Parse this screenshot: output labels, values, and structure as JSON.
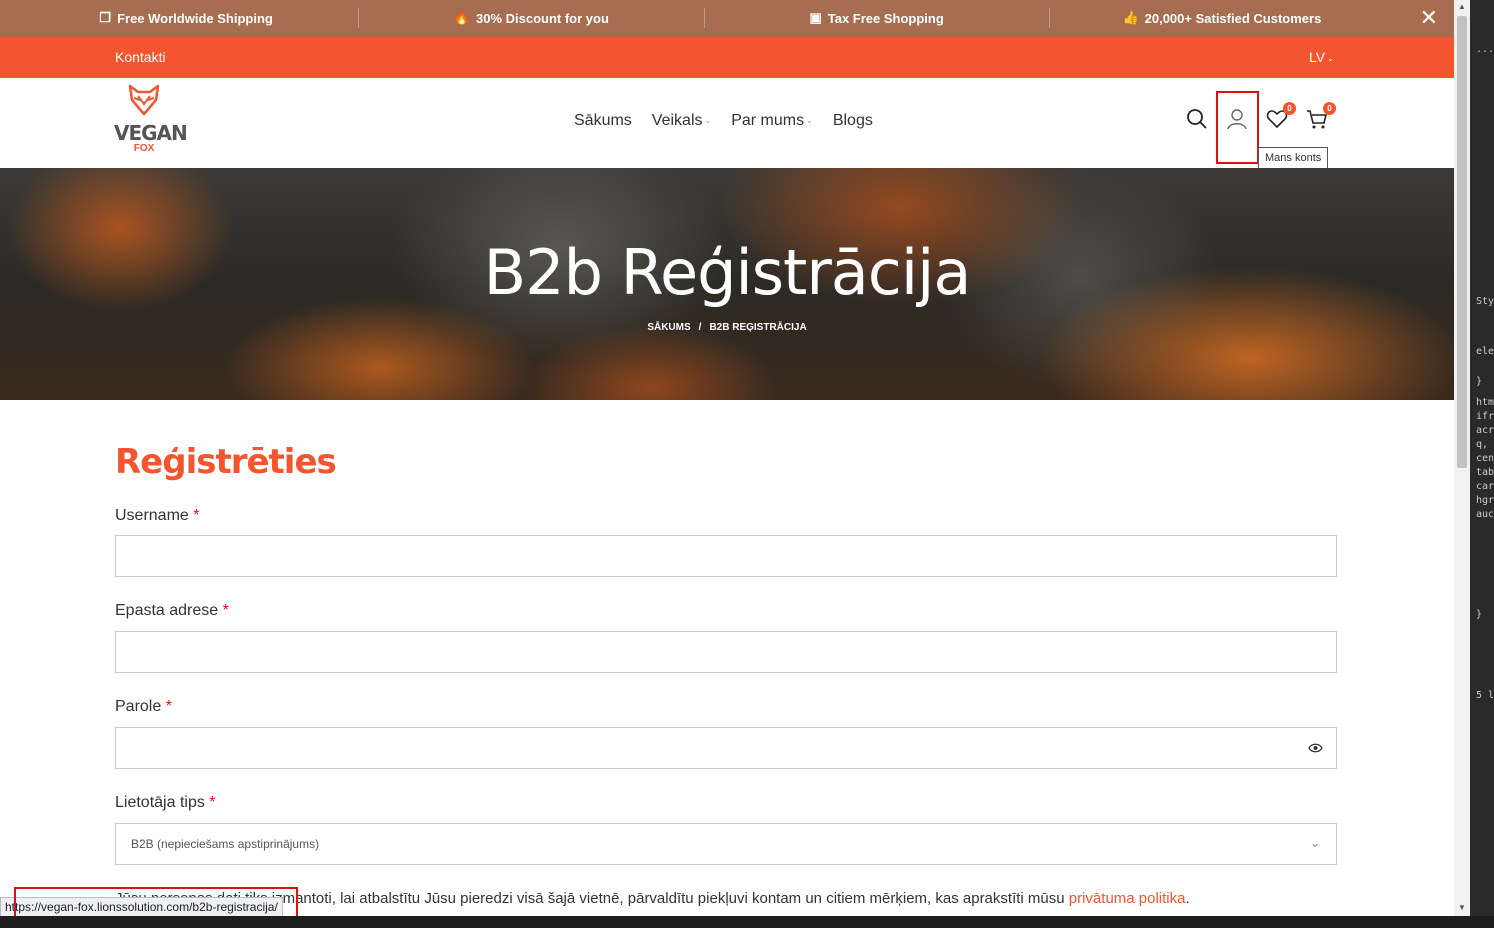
{
  "promo": {
    "items": [
      {
        "icon": "box-icon",
        "glyph": "❒",
        "label": "Free Worldwide Shipping"
      },
      {
        "icon": "fire-icon",
        "glyph": "🔥",
        "label": "30% Discount for you"
      },
      {
        "icon": "money-icon",
        "glyph": "▣",
        "label": "Tax Free Shopping"
      },
      {
        "icon": "thumbs-up-icon",
        "glyph": "👍",
        "label": "20,000+ Satisfied Customers"
      }
    ],
    "close": "✕"
  },
  "topbar": {
    "contact": "Kontakti",
    "lang": "LV"
  },
  "header": {
    "logo_text": "VEGAN",
    "logo_sub": "FOX",
    "nav": [
      {
        "label": "Sākums"
      },
      {
        "label": "Veikals"
      },
      {
        "label": "Par mums"
      },
      {
        "label": "Blogs"
      }
    ],
    "wishlist_count": "0",
    "cart_count": "0",
    "tooltip": "Mans konts"
  },
  "hero": {
    "title": "B2b Reģistrācija",
    "crumb_home": "SĀKUMS",
    "crumb_sep": "/",
    "crumb_current": "B2B REĢISTRĀCIJA"
  },
  "form": {
    "title": "Reģistrēties",
    "username_label": "Username",
    "email_label": "Epasta adrese",
    "password_label": "Parole",
    "usertype_label": "Lietotāja tips",
    "required_mark": "*",
    "usertype_value": "B2B (nepieciešams apstiprinājums)",
    "policy_text": "Jūsu personas dati tiks izmantoti, lai atbalstītu Jūsu pieredzi visā šajā vietnē, pārvaldītu piekļuvi kontam un citiem mērķiem, kas aprakstīti mūsu ",
    "policy_link": "privātuma politika",
    "policy_end": "."
  },
  "status": {
    "url": "https://vegan-fox.lionssolution.com/b2b-registracija/"
  },
  "devtools": {
    "lines": [
      "...",
      "Sty",
      "ele",
      "}",
      "htm",
      "ifr",
      "acr",
      "q,",
      "cen",
      "tab",
      "car",
      "hgr",
      "auc",
      "}",
      "5 l"
    ]
  },
  "colors": {
    "accent": "#f4552f",
    "promo_bg": "#a76d50",
    "highlight": "#e01010"
  }
}
